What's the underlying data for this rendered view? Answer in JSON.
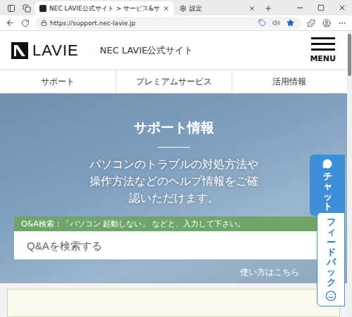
{
  "browser": {
    "tabs": [
      {
        "title": "NEC LAVIE公式サイト > サービス&サ",
        "selected": true,
        "kind": "site"
      },
      {
        "title": "設定",
        "selected": false,
        "kind": "settings"
      }
    ],
    "url": "https://support.nec-lavie.jp"
  },
  "header": {
    "logo": "LAVIE",
    "site_name": "NEC LAVIE公式サイト",
    "menu": "MENU"
  },
  "nav": [
    {
      "label": "サポート"
    },
    {
      "label": "プレミアムサービス"
    },
    {
      "label": "活用情報"
    }
  ],
  "hero": {
    "title": "サポート情報",
    "description": "パソコンのトラブルの対処方法や操作方法などのヘルプ情報をご確認いただけます。",
    "search_hint": "Q&A検索：「パソコン 起動しない」 などと、入力して下さい。",
    "search_placeholder": "Q&Aを検索する",
    "help_link": "使い方はこちら"
  },
  "side_tabs": [
    {
      "label": "チャット",
      "kind": "chat"
    },
    {
      "label": "フィードバック",
      "kind": "feedback"
    }
  ]
}
